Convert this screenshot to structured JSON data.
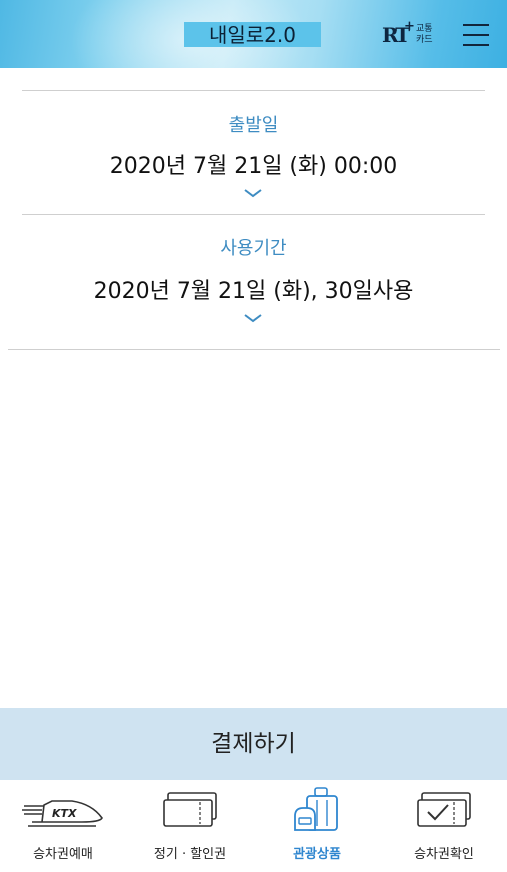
{
  "header": {
    "title": "내일로2.0",
    "card_logo_mark": "RT",
    "card_logo_line1": "교통",
    "card_logo_line2": "카드",
    "menu_icon": "hamburger-menu-icon"
  },
  "departure": {
    "label": "출발일",
    "value": "2020년 7월 21일 (화) 00:00",
    "icon": "chevron-down-icon"
  },
  "period": {
    "label": "사용기간",
    "value": "2020년 7월 21일 (화), 30일사용",
    "icon": "chevron-down-icon"
  },
  "pay_button": {
    "label": "결제하기"
  },
  "tabs": [
    {
      "label": "승차권예매",
      "icon": "ktx-train-icon",
      "active": false
    },
    {
      "label": "정기 · 할인권",
      "icon": "tickets-icon",
      "active": false
    },
    {
      "label": "관광상품",
      "icon": "luggage-icon",
      "active": true
    },
    {
      "label": "승차권확인",
      "icon": "ticket-check-icon",
      "active": false
    }
  ],
  "colors": {
    "accent": "#3e8cc2",
    "active_tab": "#2f86cf",
    "pay_button_bg": "#cfe3f1",
    "header_gradient_start": "#4fb8e4",
    "header_gradient_end": "#3db0e2"
  }
}
